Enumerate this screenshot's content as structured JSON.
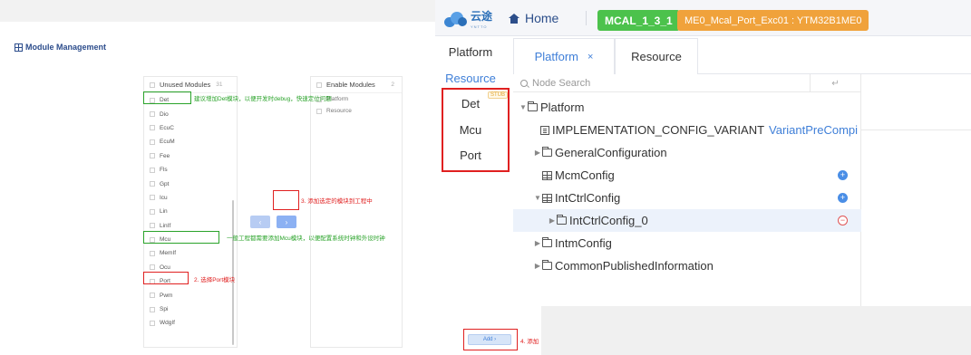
{
  "module_management": {
    "title": "Module Management",
    "unused": {
      "header": "Unused Modules",
      "count": "31",
      "items": [
        "Det",
        "Dio",
        "EcuC",
        "EcuM",
        "Fee",
        "Fls",
        "Gpt",
        "Icu",
        "Lin",
        "LinIf",
        "Mcu",
        "MemIf",
        "Ocu",
        "Port",
        "Pwm",
        "Spi",
        "WdgIf"
      ]
    },
    "enabled": {
      "header": "Enable Modules",
      "count": "2",
      "items": [
        "Platform",
        "Resource"
      ]
    },
    "transfer_left": "‹",
    "transfer_right": "›",
    "add_button": "Add ›"
  },
  "annotations": {
    "det_note": "建议增加Det模块，以便开发时debug，快速定位问题",
    "mcu_note": "一般工程都需要添加Mcu模块，以便配置系统时钟和外设时钟",
    "port_note": "2. 选择Port模块",
    "transfer_note": "3. 添加选定的模块到工程中",
    "add_note": "4. 添加"
  },
  "app": {
    "logo_text": "云途",
    "logo_sub": "YNTTO",
    "home_label": "Home",
    "mcal_badge": "MCAL_1_3_1",
    "project_badge": "ME0_Mcal_Port_Exc01 : YTM32B1ME0",
    "side_nav": [
      "Platform",
      "Resource"
    ],
    "stub_label": "STUB",
    "modules": [
      "Det",
      "Mcu",
      "Port"
    ],
    "tabs": [
      {
        "label": "Platform",
        "close": "×"
      },
      {
        "label": "Resource"
      }
    ],
    "search_placeholder": "Node Search",
    "enter_icon": "↵",
    "tree": [
      {
        "label": "Platform"
      },
      {
        "label": "IMPLEMENTATION_CONFIG_VARIANT",
        "value": "VariantPreCompi"
      },
      {
        "label": "GeneralConfiguration"
      },
      {
        "label": "McmConfig"
      },
      {
        "label": "IntCtrlConfig"
      },
      {
        "label": "IntCtrlConfig_0"
      },
      {
        "label": "IntmConfig"
      },
      {
        "label": "CommonPublishedInformation"
      }
    ]
  },
  "colors": {
    "accent_blue": "#3f7fd8",
    "badge_green": "#4cc24c",
    "badge_orange": "#f0a23b",
    "annotation_red": "#e02020",
    "annotation_green": "#2aa32a"
  }
}
